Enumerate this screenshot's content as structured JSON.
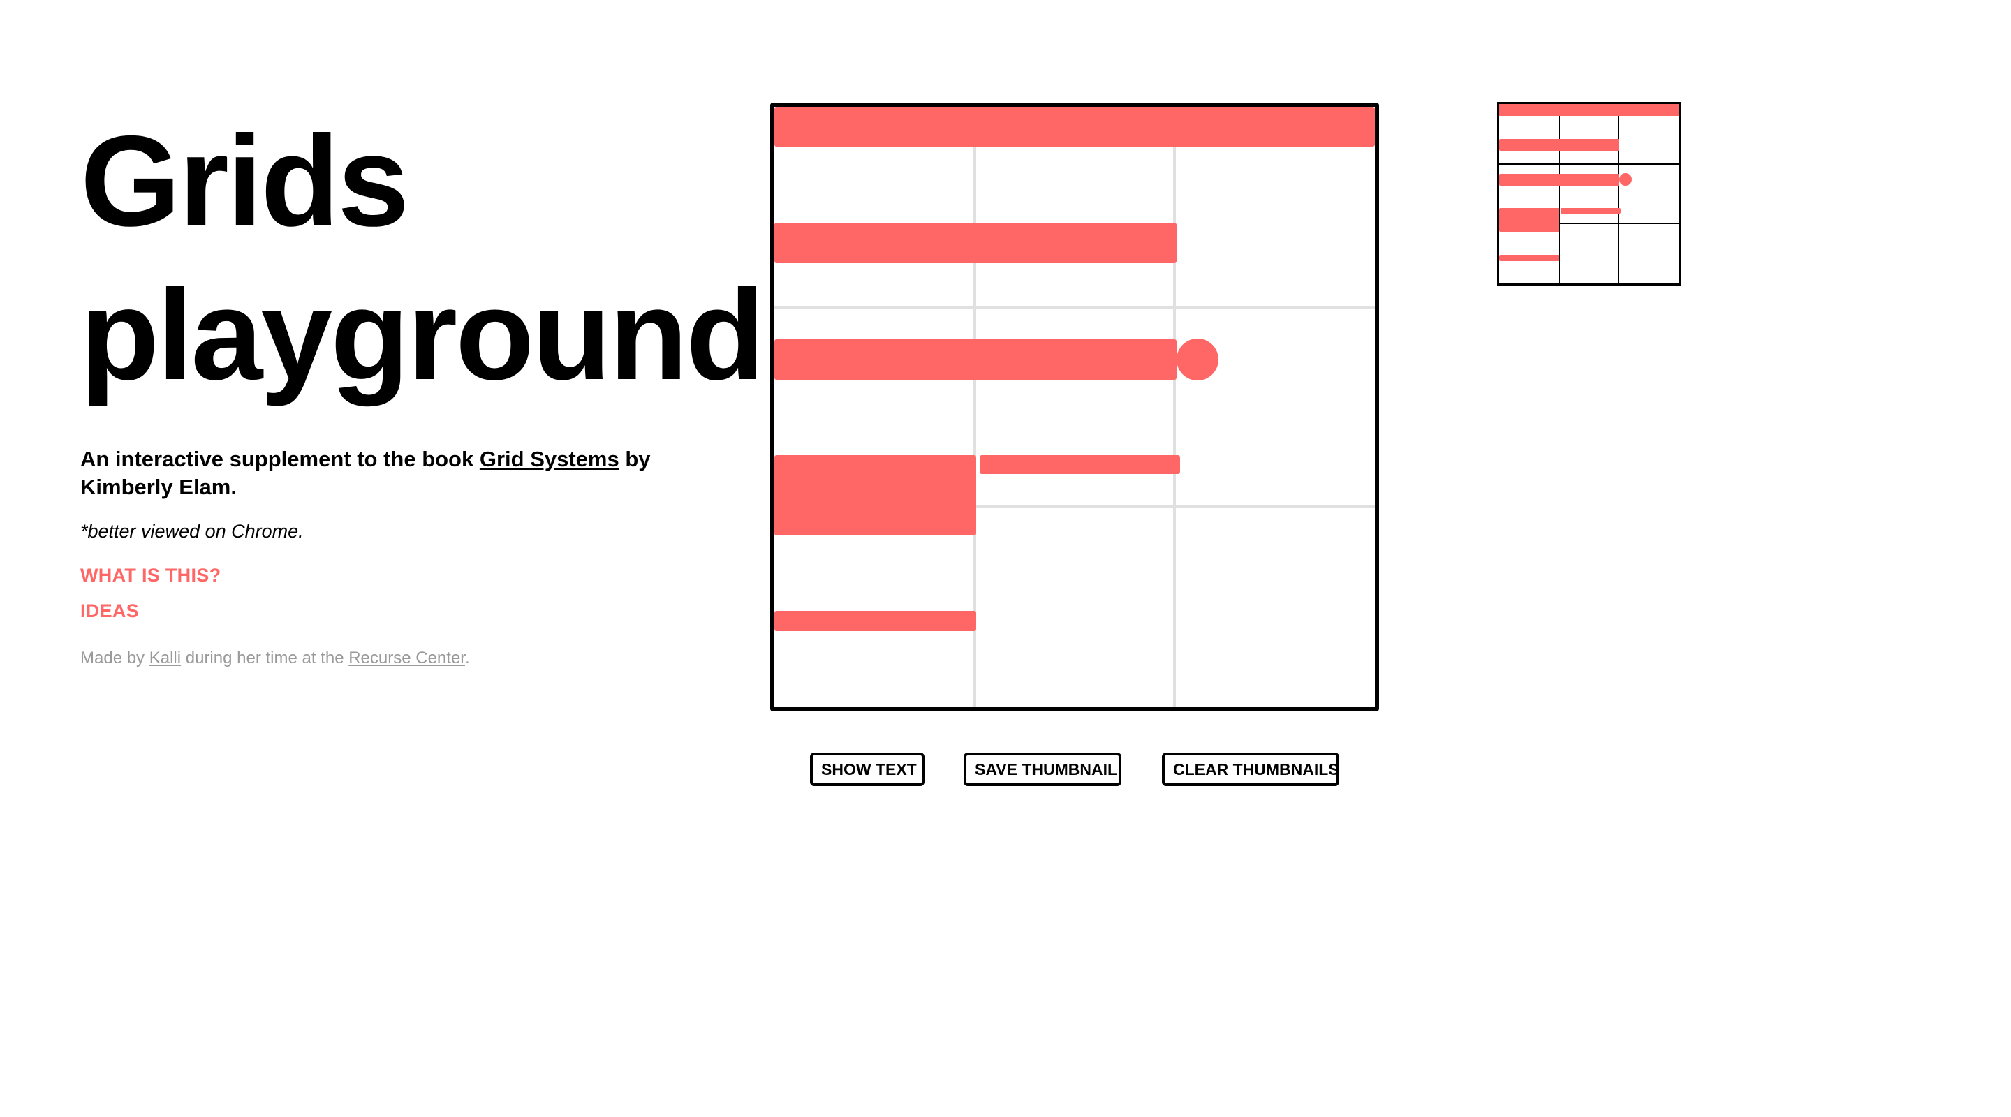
{
  "header": {
    "title_line1": "Grids",
    "title_line2": "playground",
    "subtitle_prefix": "An interactive supplement to the book ",
    "book_link": "Grid Systems",
    "subtitle_suffix": " by Kimberly Elam.",
    "note": "*better viewed on Chrome."
  },
  "nav": {
    "what_is_this": "WHAT IS THIS?",
    "ideas": "IDEAS"
  },
  "credit": {
    "prefix": "Made by ",
    "author_link": "Kalli",
    "middle": " during her time at the ",
    "place_link": "Recurse Center",
    "suffix": "."
  },
  "toolbar": {
    "show_text": "SHOW TEXT",
    "save_thumbnail": "SAVE THUMBNAIL",
    "clear_thumbnails": "CLEAR THUMBNAILS"
  },
  "colors": {
    "accent": "#ff6666",
    "grid_line": "#e0e0e0",
    "frame": "#000000"
  }
}
